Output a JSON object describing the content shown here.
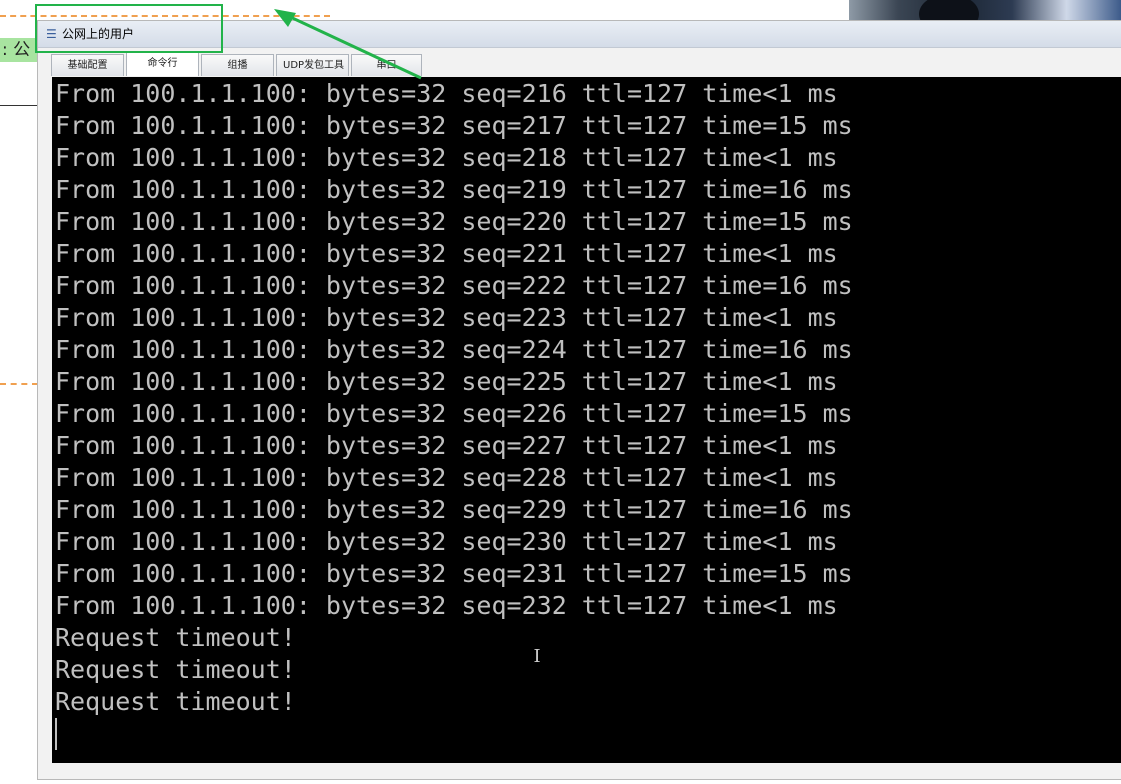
{
  "background": {
    "label_fragment": ": 公"
  },
  "window": {
    "title": "公网上的用户",
    "tabs": [
      {
        "label": "基础配置",
        "active": false
      },
      {
        "label": "命令行",
        "active": true
      },
      {
        "label": "组播",
        "active": false
      },
      {
        "label": "UDP发包工具",
        "active": false
      },
      {
        "label": "串口",
        "active": false
      }
    ]
  },
  "terminal": {
    "lines": [
      "From 100.1.1.100: bytes=32 seq=216 ttl=127 time<1 ms",
      "From 100.1.1.100: bytes=32 seq=217 ttl=127 time=15 ms",
      "From 100.1.1.100: bytes=32 seq=218 ttl=127 time<1 ms",
      "From 100.1.1.100: bytes=32 seq=219 ttl=127 time=16 ms",
      "From 100.1.1.100: bytes=32 seq=220 ttl=127 time=15 ms",
      "From 100.1.1.100: bytes=32 seq=221 ttl=127 time<1 ms",
      "From 100.1.1.100: bytes=32 seq=222 ttl=127 time=16 ms",
      "From 100.1.1.100: bytes=32 seq=223 ttl=127 time<1 ms",
      "From 100.1.1.100: bytes=32 seq=224 ttl=127 time=16 ms",
      "From 100.1.1.100: bytes=32 seq=225 ttl=127 time<1 ms",
      "From 100.1.1.100: bytes=32 seq=226 ttl=127 time=15 ms",
      "From 100.1.1.100: bytes=32 seq=227 ttl=127 time<1 ms",
      "From 100.1.1.100: bytes=32 seq=228 ttl=127 time<1 ms",
      "From 100.1.1.100: bytes=32 seq=229 ttl=127 time=16 ms",
      "From 100.1.1.100: bytes=32 seq=230 ttl=127 time<1 ms",
      "From 100.1.1.100: bytes=32 seq=231 ttl=127 time=15 ms",
      "From 100.1.1.100: bytes=32 seq=232 ttl=127 time<1 ms",
      "Request timeout!",
      "Request timeout!",
      "Request timeout!"
    ],
    "text_color": "#c0c0c0",
    "background_color": "#000000"
  },
  "annotation": {
    "box_color": "#22b34a",
    "arrow_color": "#22b34a"
  },
  "icons": {
    "window_icon": "app-window-icon",
    "text_cursor": "text-cursor-icon"
  },
  "colors": {
    "dashed_line": "#f0a050",
    "label_background": "#a8e4a0"
  }
}
